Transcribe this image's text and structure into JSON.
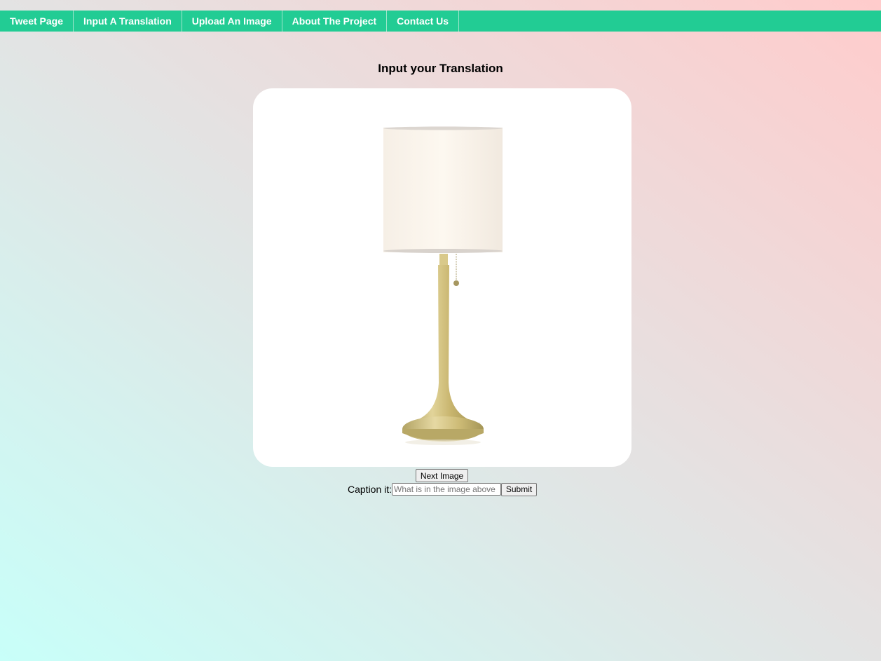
{
  "nav": {
    "items": [
      {
        "label": "Tweet Page"
      },
      {
        "label": "Input A Translation"
      },
      {
        "label": "Upload An Image"
      },
      {
        "label": "About The Project"
      },
      {
        "label": "Contact Us"
      }
    ]
  },
  "main": {
    "title": "Input your Translation",
    "image_subject": "table-lamp-photo",
    "next_button_label": "Next Image",
    "caption_label": "Caption it:",
    "caption_value": "",
    "caption_placeholder": "What is in the image above",
    "submit_label": "Submit"
  },
  "colors": {
    "nav_background": "#22cc94",
    "gradient_bottom_left": "#c8fff9",
    "gradient_top_right": "#ffcccc"
  }
}
